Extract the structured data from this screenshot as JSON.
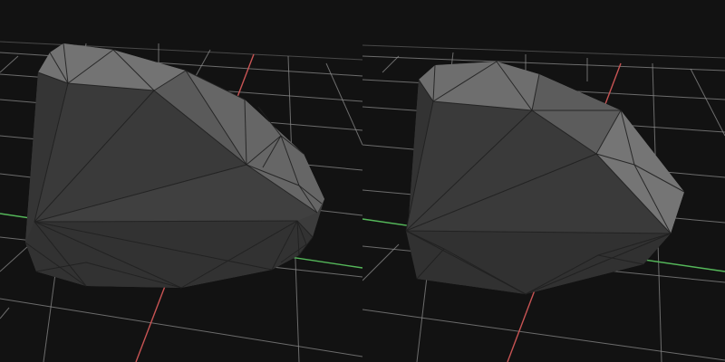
{
  "viewports": [
    {
      "id": "left",
      "mesh": "smoothed-convex-hull",
      "shading": "flat-gray",
      "colors": {
        "background": "#121212",
        "grid": "#8a8a8a",
        "x_axis": "#c85454",
        "z_axis": "#55b85a",
        "face_light": "#7a7a7a",
        "face_mid": "#5e5e5e",
        "face_dark": "#3a3a3a",
        "face_darker": "#2f2f2f",
        "edge": "#202020"
      }
    },
    {
      "id": "right",
      "mesh": "faceted-convex-hull",
      "shading": "flat-gray",
      "colors": {
        "background": "#121212",
        "grid": "#8a8a8a",
        "x_axis": "#c85454",
        "z_axis": "#55b85a",
        "face_light": "#767676",
        "face_mid": "#5a5a5a",
        "face_dark": "#383838",
        "face_darker": "#2e2e2e",
        "edge": "#202020"
      }
    }
  ]
}
